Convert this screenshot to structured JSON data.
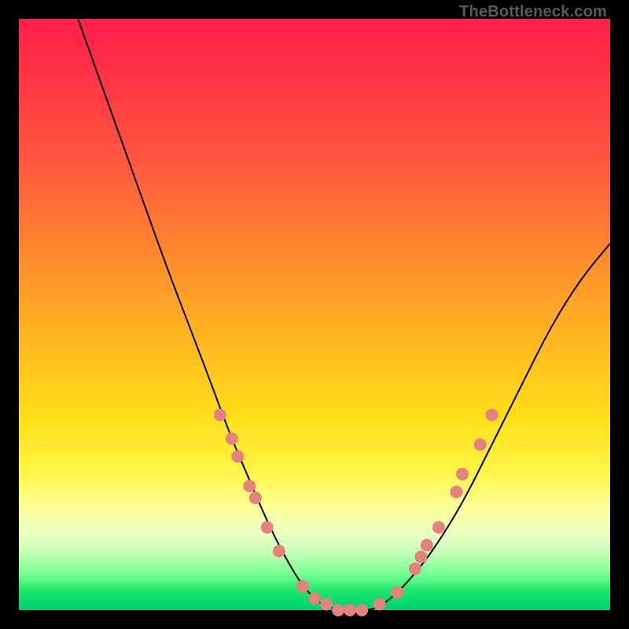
{
  "watermark": "TheBottleneck.com",
  "colors": {
    "page_bg": "#000000",
    "curve": "#000000",
    "marker_fill": "#e5827e",
    "gradient_top": "#ff1f4a",
    "gradient_bottom": "#00d075"
  },
  "chart_data": {
    "type": "line",
    "title": "",
    "xlabel": "",
    "ylabel": "",
    "xlim": [
      0,
      100
    ],
    "ylim": [
      0,
      100
    ],
    "grid": false,
    "legend": false,
    "series": [
      {
        "name": "curve",
        "x": [
          10,
          15,
          20,
          25,
          30,
          33,
          36,
          39,
          42,
          45,
          48,
          51,
          54,
          57,
          60,
          63,
          66,
          70,
          75,
          80,
          85,
          90,
          95,
          100
        ],
        "values": [
          100,
          86,
          72,
          58,
          45,
          37,
          29,
          22,
          15,
          9,
          4,
          1,
          0,
          0,
          0,
          2,
          5,
          10,
          18,
          28,
          38,
          48,
          56,
          62
        ]
      }
    ],
    "markers": [
      {
        "x": 34,
        "y": 33
      },
      {
        "x": 36,
        "y": 29
      },
      {
        "x": 37,
        "y": 26
      },
      {
        "x": 39,
        "y": 21
      },
      {
        "x": 40,
        "y": 19
      },
      {
        "x": 42,
        "y": 14
      },
      {
        "x": 44,
        "y": 10
      },
      {
        "x": 48,
        "y": 4
      },
      {
        "x": 50,
        "y": 2
      },
      {
        "x": 52,
        "y": 1
      },
      {
        "x": 54,
        "y": 0
      },
      {
        "x": 56,
        "y": 0
      },
      {
        "x": 58,
        "y": 0
      },
      {
        "x": 61,
        "y": 1
      },
      {
        "x": 64,
        "y": 3
      },
      {
        "x": 67,
        "y": 7
      },
      {
        "x": 68,
        "y": 9
      },
      {
        "x": 69,
        "y": 11
      },
      {
        "x": 71,
        "y": 14
      },
      {
        "x": 74,
        "y": 20
      },
      {
        "x": 75,
        "y": 23
      },
      {
        "x": 78,
        "y": 28
      },
      {
        "x": 80,
        "y": 33
      }
    ]
  }
}
